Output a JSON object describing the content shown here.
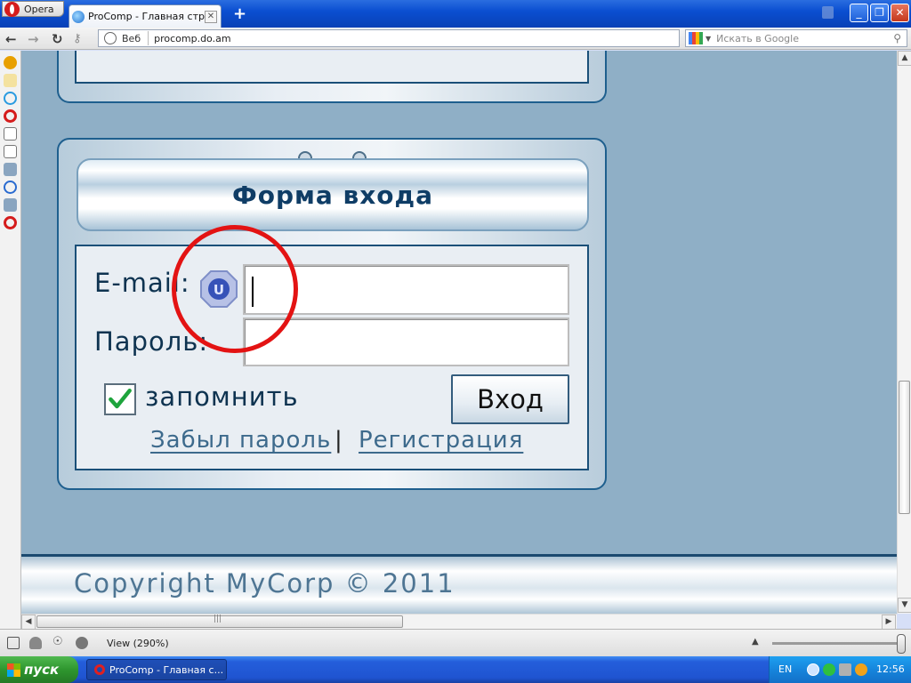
{
  "browser": {
    "menu_label": "Opera",
    "tab_title": "ProComp - Главная стр...",
    "tab_close": "✕",
    "new_tab": "+",
    "win_minimize": "_",
    "win_restore": "❐",
    "win_close": "✕",
    "address": {
      "web_label": "Веб",
      "url": "procomp.do.am"
    },
    "search": {
      "placeholder": "Искать в Google"
    }
  },
  "page": {
    "form": {
      "title": "Форма входа",
      "email_label": "E-mail:",
      "password_label": "Пароль:",
      "remember_label": "запомнить",
      "remember_checked": true,
      "login_button": "Вход",
      "forgot_link": "Забыл пароль",
      "separator": "|",
      "register_link": "Регистрация"
    },
    "footer": {
      "copyright": "Copyright MyCorp © 2011"
    }
  },
  "statusbar": {
    "zoom_text": "View (290%)"
  },
  "taskbar": {
    "start_label": "пуск",
    "task_label": "ProComp - Главная с...",
    "language": "EN",
    "clock": "12:56"
  },
  "colors": {
    "page_bg": "#8fafc6",
    "title_text": "#0f3d66",
    "link": "#3d6a8c",
    "highlight_circle": "#e31313"
  }
}
